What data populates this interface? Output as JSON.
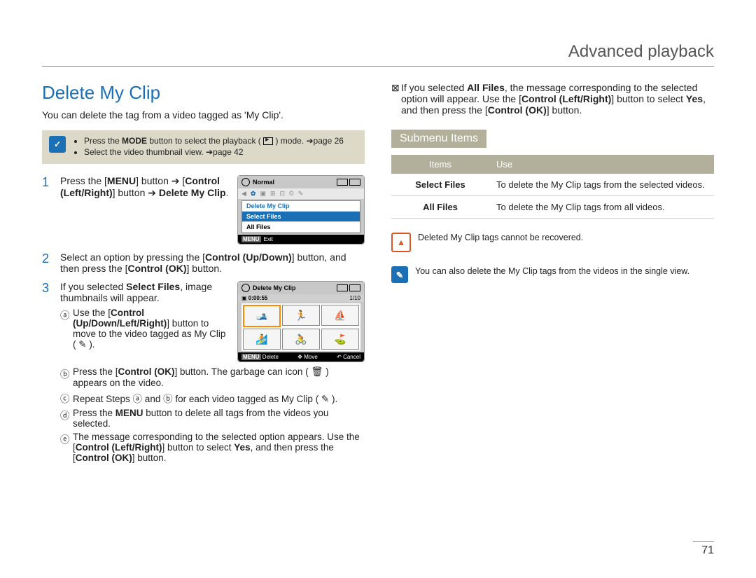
{
  "header": {
    "title": "Advanced playback"
  },
  "page_number": "71",
  "left": {
    "section_title": "Delete My Clip",
    "intro": "You can delete the tag from a video tagged as 'My Clip'.",
    "tip": {
      "line1_a": "Press the ",
      "line1_b": "MODE",
      "line1_c": " button to select the playback ( ",
      "line1_d": " ) mode. ➔page 26",
      "line2": "Select the video thumbnail view. ➔page 42"
    },
    "step1": {
      "num": "1",
      "a": "Press the [",
      "b": "MENU",
      "c": "] button ➔ [",
      "d": "Control (Left/Right)",
      "e": "] button ➔ ",
      "f": "Delete My Clip",
      "g": "."
    },
    "step2": {
      "num": "2",
      "a": "Select an option by pressing the [",
      "b": "Control (Up/Down)",
      "c": "] button, and then press the [",
      "d": "Control (OK)",
      "e": "] button."
    },
    "step3": {
      "num": "3",
      "a": "If you selected ",
      "b": "Select Files",
      "c": ", image thumbnails will appear.",
      "sub_a": {
        "label": "ⓐ",
        "t1": "Use the [",
        "t2": "Control (Up/Down/Left/Right)",
        "t3": "] button to move to the video tagged as My Clip ( ",
        "t4": " )."
      },
      "sub_b": {
        "label": "ⓑ",
        "t1": "Press the [",
        "t2": "Control (OK)",
        "t3": "] button. The garbage can icon ( ",
        "t4": " ) appears on the video."
      },
      "sub_c": {
        "label": "ⓒ",
        "t1": "Repeat Steps ⓐ and ⓑ for each video tagged as My Clip ( ",
        "t2": " )."
      },
      "sub_d": {
        "label": "ⓓ",
        "t1": "Press the ",
        "t2": "MENU",
        "t3": " button to delete all tags from the videos you selected."
      },
      "sub_e": {
        "label": "ⓔ",
        "t1": "The message corresponding to the selected option appears. Use the [",
        "t2": "Control (Left/Right)",
        "t3": "] button to select ",
        "t4": "Yes",
        "t5": ", and then press the [",
        "t6": "Control (OK)",
        "t7": "] button."
      }
    },
    "screen1": {
      "top": "Normal",
      "menu_title": "Delete My Clip",
      "menu_sel": "Select Files",
      "menu_opt": "All Files",
      "bottom_tag": "MENU",
      "bottom_txt": "Exit"
    },
    "screen2": {
      "top": "Delete My Clip",
      "time": "0:00:55",
      "count": "1/10",
      "b_tag1": "MENU",
      "b_txt1": "Delete",
      "b_txt2": "Move",
      "b_txt3": "Cancel"
    }
  },
  "right": {
    "top": {
      "a": "If you selected ",
      "b": "All Files",
      "c": ", the message corresponding to the selected option will appear. Use the [",
      "d": "Control (Left/Right)",
      "e": "] button to select ",
      "f": "Yes",
      "g": ", and then press the [",
      "h": "Control (OK)",
      "i": "] button."
    },
    "subhead": "Submenu Items",
    "table": {
      "h1": "Items",
      "h2": "Use",
      "r1c1": "Select Files",
      "r1c2": "To delete the My Clip tags from the selected videos.",
      "r2c1": "All Files",
      "r2c2": "To delete the My Clip tags from all videos."
    },
    "warn": "Deleted My Clip tags cannot be recovered.",
    "info": "You can also delete the My Clip tags from the videos in the single view."
  }
}
